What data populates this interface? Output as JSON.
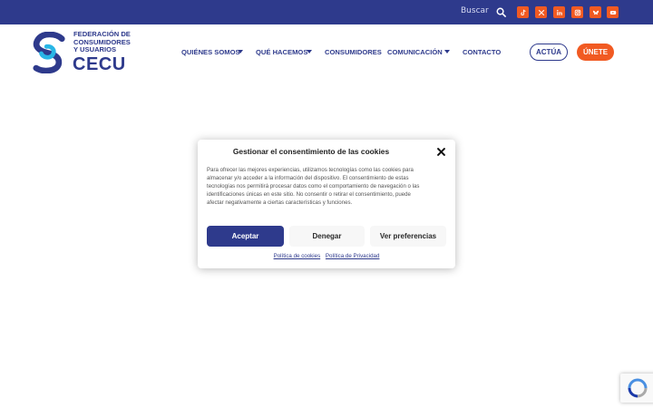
{
  "topbar": {
    "search_label": "Buscar",
    "search_icon": "search-icon",
    "social_icons": [
      "tiktok-icon",
      "x-icon",
      "linkedin-icon",
      "instagram-icon",
      "bluesky-icon",
      "youtube-icon"
    ]
  },
  "logo": {
    "line1": "FEDERACIÓN DE",
    "line2": "CONSUMIDORES",
    "line3": "Y USUARIOS",
    "brand": "CECU"
  },
  "nav": {
    "items": [
      {
        "label": "QUIÉNES SOMOS",
        "has_dropdown": true
      },
      {
        "label": "QUÉ HACEMOS",
        "has_dropdown": true
      },
      {
        "label": "CONSUMIDORES",
        "has_dropdown": false
      },
      {
        "label": "COMUNICACIÓN",
        "has_dropdown": true
      },
      {
        "label": "CONTACTO",
        "has_dropdown": false
      }
    ],
    "actua_label": "ACTÚA",
    "unete_label": "ÚNETE"
  },
  "cookie_modal": {
    "title": "Gestionar el consentimiento de las cookies",
    "body": "Para ofrecer las mejores experiencias, utilizamos tecnologías como las cookies para almacenar y/o acceder a la información del dispositivo. El consentimiento de estas tecnologías nos permitirá procesar datos como el comportamiento de navegación o las identificaciones únicas en este sitio. No consentir o retirar el consentimiento, puede afectar negativamente a ciertas características y funciones.",
    "accept_label": "Aceptar",
    "deny_label": "Denegar",
    "prefs_label": "Ver preferencias",
    "cookie_policy_link": "Política de cookies",
    "privacy_policy_link": "Política de Privacidad"
  },
  "colors": {
    "primary": "#2e3a8c",
    "accent": "#f15a22",
    "logo_cyan": "#29b6e6"
  }
}
